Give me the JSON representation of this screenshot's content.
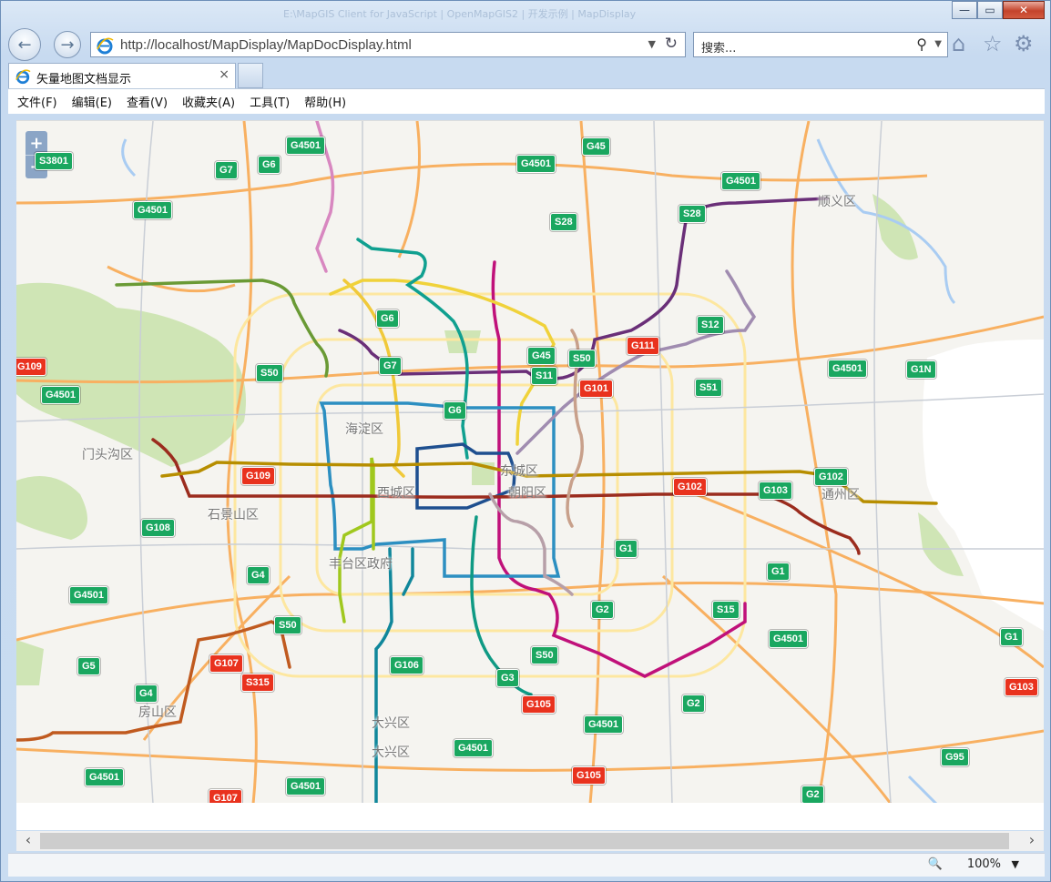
{
  "window": {
    "caption_ghost": "E:\\MapGIS Client for JavaScript | OpenMapGIS2 | 开发示例 | MapDisplay",
    "minimize": "—",
    "maximize": "▭",
    "close": "✕"
  },
  "nav": {
    "url": "http://localhost/MapDisplay/MapDocDisplay.html",
    "search_placeholder": "搜索...",
    "back_icon": "back-arrow-icon",
    "forward_icon": "forward-arrow-icon"
  },
  "tab": {
    "title": "矢量地图文档显示",
    "close": "×"
  },
  "menu": [
    "文件(F)",
    "编辑(E)",
    "查看(V)",
    "收藏夹(A)",
    "工具(T)",
    "帮助(H)"
  ],
  "map": {
    "zoom_in": "+",
    "zoom_out": "−",
    "districts": [
      "顺义区",
      "海淀区",
      "门头沟区",
      "东城区",
      "西城区",
      "朝阳区",
      "通州区",
      "石景山区",
      "丰台区政府",
      "房山区",
      "大兴区",
      "大兴区"
    ],
    "highway_labels": [
      "S3801",
      "G7",
      "G6",
      "G4501",
      "G45",
      "G4501",
      "G4501",
      "S28",
      "S28",
      "G4501",
      "G6",
      "S12",
      "G111",
      "G45",
      "S50",
      "G7",
      "S11",
      "G101",
      "S50",
      "S51",
      "G4501",
      "G1N",
      "G109",
      "G4501",
      "G6",
      "G102",
      "G103",
      "G102",
      "G109",
      "G108",
      "G1",
      "G1",
      "G4",
      "G4501",
      "G2",
      "S15",
      "S50",
      "G4501",
      "G5",
      "G107",
      "S315",
      "G106",
      "G3",
      "S50",
      "G4",
      "G105",
      "G2",
      "G4501",
      "G1",
      "G103",
      "G4501",
      "G4501",
      "G95",
      "G105",
      "G4501",
      "G107",
      "G2"
    ]
  },
  "status": {
    "zoom": "100%"
  },
  "colors": {
    "green_badge": "#1aa760",
    "red_badge": "#e9321e",
    "road_orange": "#f5a04b"
  }
}
